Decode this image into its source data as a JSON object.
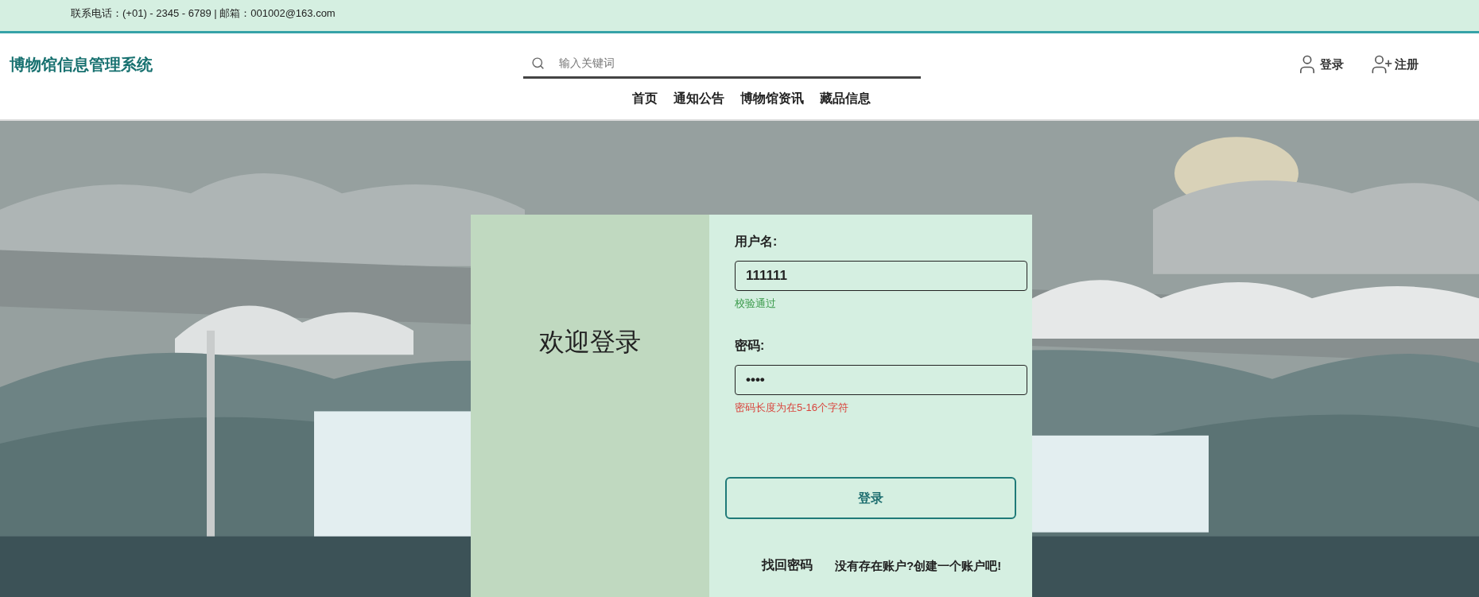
{
  "top_bar": {
    "contact": "联系电话：(+01) - 2345 - 6789 | 邮箱：001002@163.com"
  },
  "header": {
    "site_title": "博物馆信息管理系统",
    "search": {
      "placeholder": "输入关键词"
    },
    "actions": [
      {
        "kind": "login",
        "label": "登录"
      },
      {
        "kind": "register",
        "label": "注册"
      }
    ]
  },
  "nav": [
    {
      "label": "首页"
    },
    {
      "label": "通知公告"
    },
    {
      "label": "博物馆资讯"
    },
    {
      "label": "藏品信息"
    }
  ],
  "login_panel": {
    "welcome": "欢迎登录",
    "fields": [
      {
        "label": "用户名:",
        "value": "111111",
        "message": "校验通过",
        "valid": true
      },
      {
        "label": "密码:",
        "value": "••••",
        "message": "密码长度为在5-16个字符",
        "valid": false
      }
    ],
    "submit": "登录",
    "links": [
      "找回密码",
      "没有存在账户?创建一个账户吧!"
    ]
  }
}
